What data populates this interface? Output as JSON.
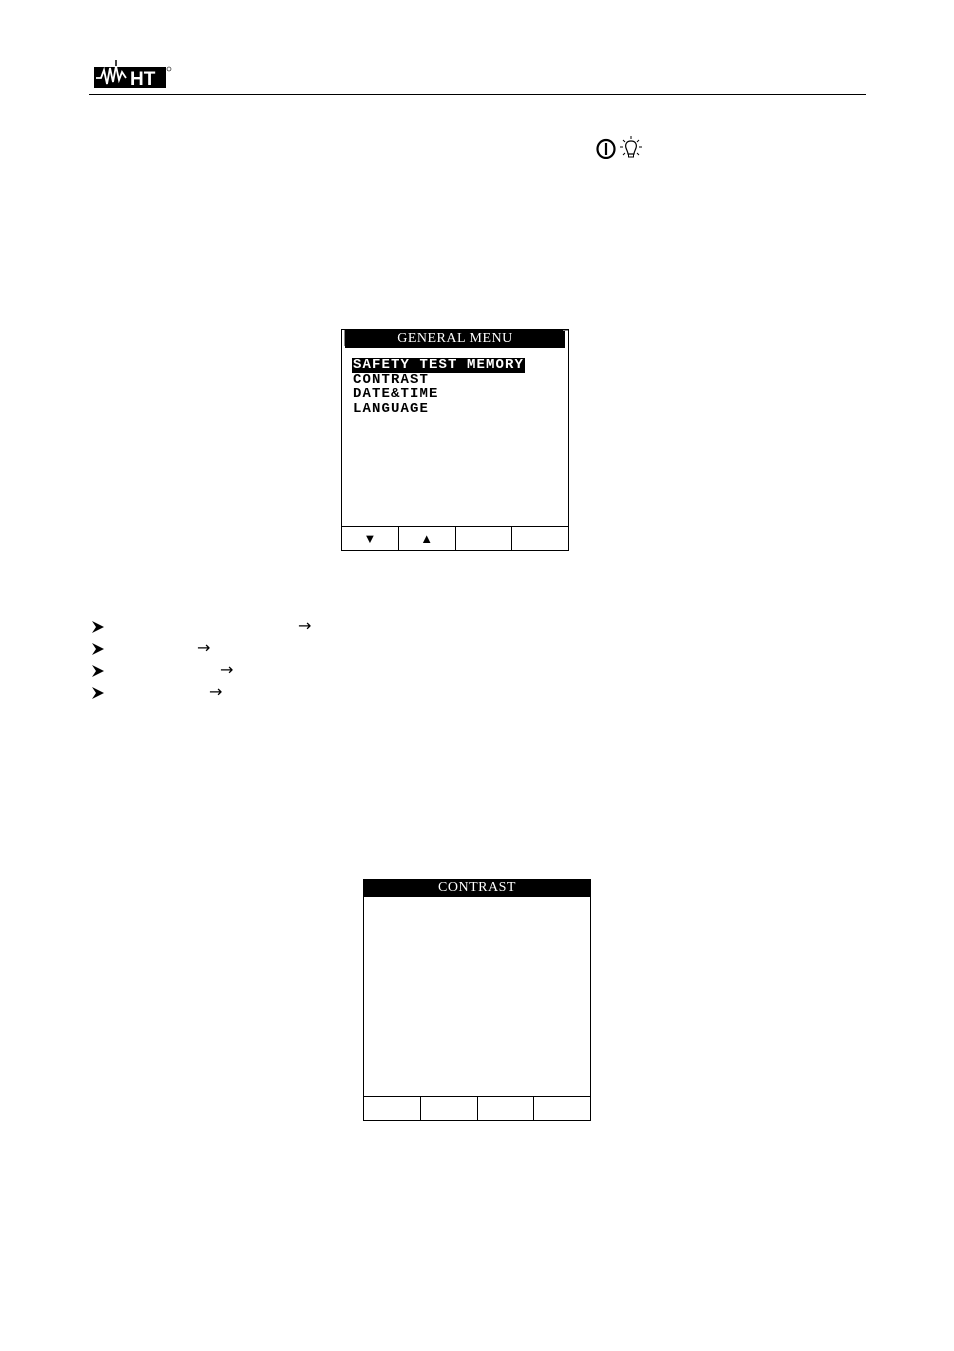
{
  "header": {
    "logo_text": "HT",
    "logo_mark": "registered-mark"
  },
  "key_icons": [
    {
      "name": "power-icon",
      "glyph": "power-button"
    },
    {
      "name": "backlight-icon",
      "glyph": "light-bulb"
    }
  ],
  "general_menu_screen": {
    "title": "GENERAL MENU",
    "items": [
      {
        "label": "SAFETY TEST MEMORY",
        "selected": true
      },
      {
        "label": "CONTRAST",
        "selected": false
      },
      {
        "label": "DATE&TIME",
        "selected": false
      },
      {
        "label": "LANGUAGE",
        "selected": false
      }
    ],
    "softkeys": [
      {
        "icon": "triangle-down-icon",
        "glyph": "▼"
      },
      {
        "icon": "triangle-up-icon",
        "glyph": "▲"
      },
      {
        "icon": "",
        "glyph": ""
      },
      {
        "icon": "",
        "glyph": ""
      }
    ]
  },
  "bullet_list": [
    {
      "marker": "arrowhead-bullet",
      "arrow": "→"
    },
    {
      "marker": "arrowhead-bullet",
      "arrow": "→"
    },
    {
      "marker": "arrowhead-bullet",
      "arrow": "→"
    },
    {
      "marker": "arrowhead-bullet",
      "arrow": "→"
    }
  ],
  "contrast_screen": {
    "title": "CONTRAST",
    "softkeys": [
      {
        "glyph": ""
      },
      {
        "glyph": ""
      },
      {
        "glyph": ""
      },
      {
        "glyph": ""
      }
    ]
  }
}
